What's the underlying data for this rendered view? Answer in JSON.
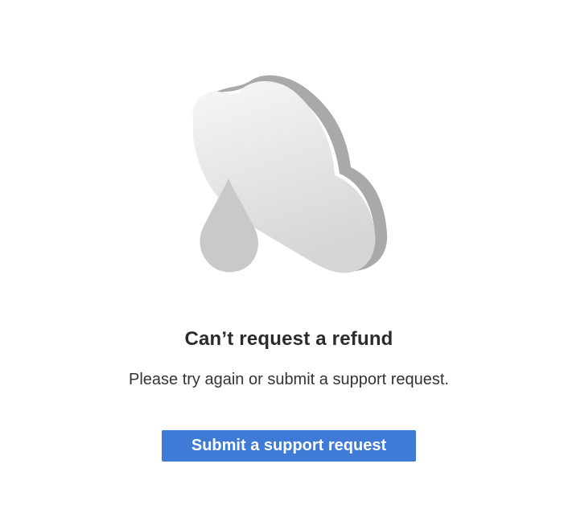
{
  "illustration": {
    "icon": "cloud-with-raindrop-icon",
    "colors": {
      "cloud_face_top": "#f4f4f4",
      "cloud_face_bottom": "#d8d8d8",
      "cloud_side": "#a9a9a9",
      "raindrop": "#c9c9c9"
    }
  },
  "error": {
    "title": "Can’t request a refund",
    "message": "Please try again or submit a support request."
  },
  "actions": {
    "support_button_label": "Submit a support request",
    "support_button_color": "#3f7bd6"
  }
}
